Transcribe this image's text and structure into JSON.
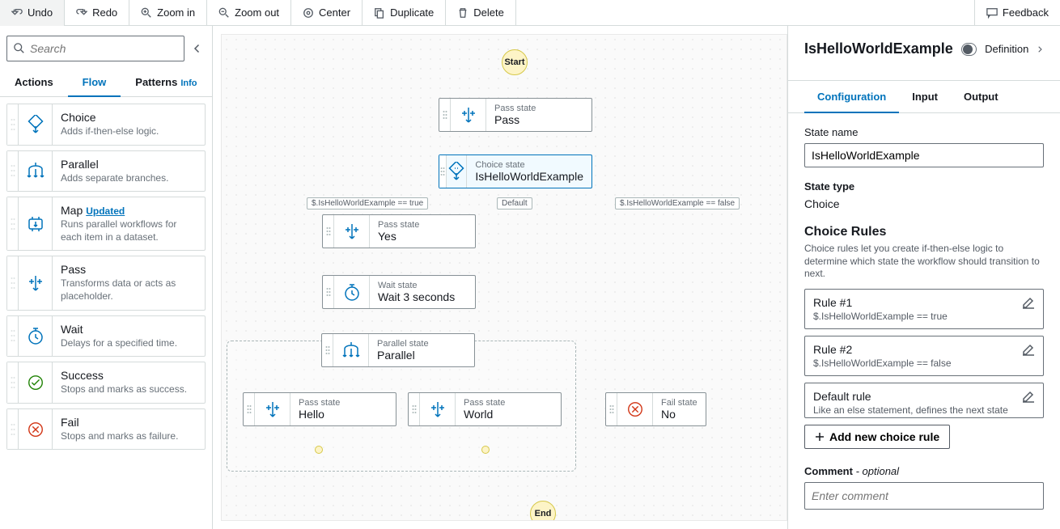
{
  "toolbar": {
    "undo": "Undo",
    "redo": "Redo",
    "zoom_in": "Zoom in",
    "zoom_out": "Zoom out",
    "center": "Center",
    "duplicate": "Duplicate",
    "delete": "Delete",
    "feedback": "Feedback"
  },
  "search": {
    "placeholder": "Search"
  },
  "tabs": {
    "actions": "Actions",
    "flow": "Flow",
    "patterns": "Patterns",
    "info": "Info"
  },
  "flow_items": [
    {
      "title": "Choice",
      "desc": "Adds if-then-else logic."
    },
    {
      "title": "Parallel",
      "desc": "Adds separate branches."
    },
    {
      "title": "Map",
      "badge": "Updated",
      "desc": "Runs parallel workflows for each item in a dataset."
    },
    {
      "title": "Pass",
      "desc": "Transforms data or acts as placeholder."
    },
    {
      "title": "Wait",
      "desc": "Delays for a specified time."
    },
    {
      "title": "Success",
      "desc": "Stops and marks as success."
    },
    {
      "title": "Fail",
      "desc": "Stops and marks as failure."
    }
  ],
  "canvas": {
    "start": "Start",
    "end": "End",
    "labels": {
      "true_cond": "$.IsHelloWorldExample == true",
      "default_cond": "Default",
      "false_cond": "$.IsHelloWorldExample == false"
    },
    "nodes": {
      "pass1": {
        "type": "Pass state",
        "name": "Pass"
      },
      "choice": {
        "type": "Choice state",
        "name": "IsHelloWorldExample"
      },
      "yes": {
        "type": "Pass state",
        "name": "Yes"
      },
      "wait": {
        "type": "Wait state",
        "name": "Wait 3 seconds"
      },
      "parallel": {
        "type": "Parallel state",
        "name": "Parallel"
      },
      "hello": {
        "type": "Pass state",
        "name": "Hello"
      },
      "world": {
        "type": "Pass state",
        "name": "World"
      },
      "no": {
        "type": "Fail state",
        "name": "No"
      }
    }
  },
  "right": {
    "title": "IsHelloWorldExample",
    "toggle_label": "Definition",
    "tabs": {
      "configuration": "Configuration",
      "input": "Input",
      "output": "Output"
    },
    "state_name_label": "State name",
    "state_name_value": "IsHelloWorldExample",
    "state_type_label": "State type",
    "state_type_value": "Choice",
    "rules": {
      "heading": "Choice Rules",
      "desc": "Choice rules let you create if-then-else logic to determine which state the workflow should transition to next.",
      "r1": {
        "title": "Rule #1",
        "sub": "$.IsHelloWorldExample == true"
      },
      "r2": {
        "title": "Rule #2",
        "sub": "$.IsHelloWorldExample == false"
      },
      "default": {
        "title": "Default rule",
        "sub": "Like an else statement, defines the next state when no rule is true."
      },
      "add": "Add new choice rule"
    },
    "comment": {
      "label": "Comment",
      "optional": " - optional",
      "placeholder": "Enter comment"
    }
  }
}
